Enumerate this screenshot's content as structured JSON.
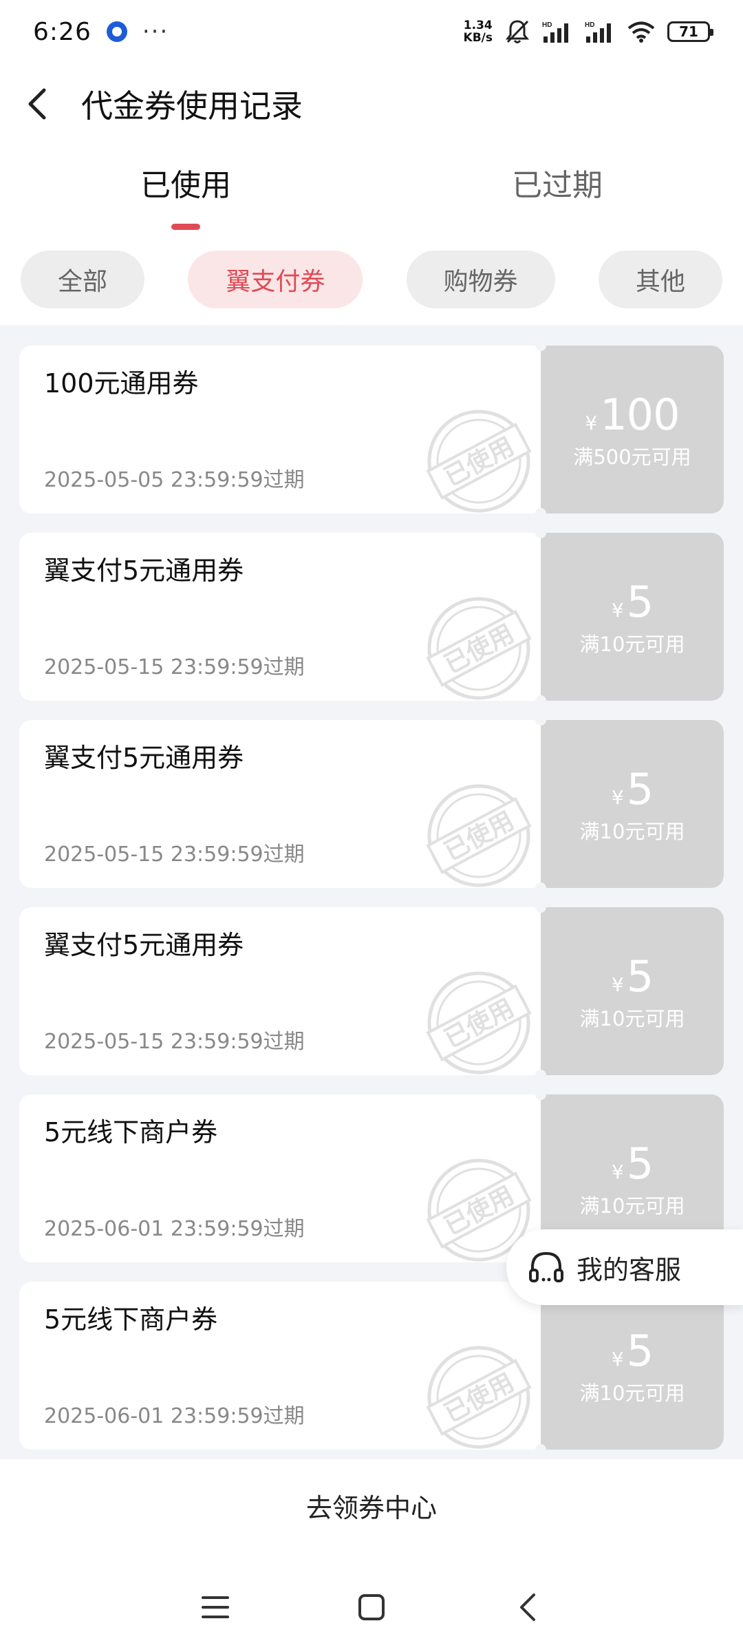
{
  "status_bar": {
    "time": "6:26",
    "more": "···",
    "speed_value": "1.34",
    "speed_unit": "KB/s",
    "battery": "71",
    "icons": [
      "mute-bell-icon",
      "signal-hd-icon",
      "signal-hd-icon",
      "wifi-icon",
      "battery-icon"
    ]
  },
  "header": {
    "title": "代金券使用记录",
    "back_icon": "chevron-left-icon"
  },
  "tabs": [
    {
      "label": "已使用",
      "active": true
    },
    {
      "label": "已过期",
      "active": false
    }
  ],
  "filters": [
    {
      "label": "全部",
      "selected": false
    },
    {
      "label": "翼支付券",
      "selected": true
    },
    {
      "label": "购物券",
      "selected": false
    },
    {
      "label": "其他",
      "selected": false
    }
  ],
  "coupons": [
    {
      "title": "100元通用券",
      "expiry": "2025-05-05 23:59:59过期",
      "currency": "¥",
      "amount": "100",
      "condition": "满500元可用",
      "stamp": "已使用"
    },
    {
      "title": "翼支付5元通用券",
      "expiry": "2025-05-15 23:59:59过期",
      "currency": "¥",
      "amount": "5",
      "condition": "满10元可用",
      "stamp": "已使用"
    },
    {
      "title": "翼支付5元通用券",
      "expiry": "2025-05-15 23:59:59过期",
      "currency": "¥",
      "amount": "5",
      "condition": "满10元可用",
      "stamp": "已使用"
    },
    {
      "title": "翼支付5元通用券",
      "expiry": "2025-05-15 23:59:59过期",
      "currency": "¥",
      "amount": "5",
      "condition": "满10元可用",
      "stamp": "已使用"
    },
    {
      "title": "5元线下商户券",
      "expiry": "2025-06-01 23:59:59过期",
      "currency": "¥",
      "amount": "5",
      "condition": "满10元可用",
      "stamp": "已使用"
    },
    {
      "title": "5元线下商户券",
      "expiry": "2025-06-01 23:59:59过期",
      "currency": "¥",
      "amount": "5",
      "condition": "满10元可用",
      "stamp": "已使用"
    }
  ],
  "service_float": {
    "label": "我的客服",
    "icon": "headset-icon"
  },
  "bottom": {
    "link_label": "去领券中心"
  },
  "nav_bar": {
    "icons": [
      "menu-icon",
      "home-square-icon",
      "back-triangle-icon"
    ]
  },
  "colors": {
    "accent": "#e04a55",
    "chip_selected_bg": "#fbe6e7",
    "coupon_used_right": "#d4d4d4",
    "list_bg": "#f3f4f8"
  }
}
